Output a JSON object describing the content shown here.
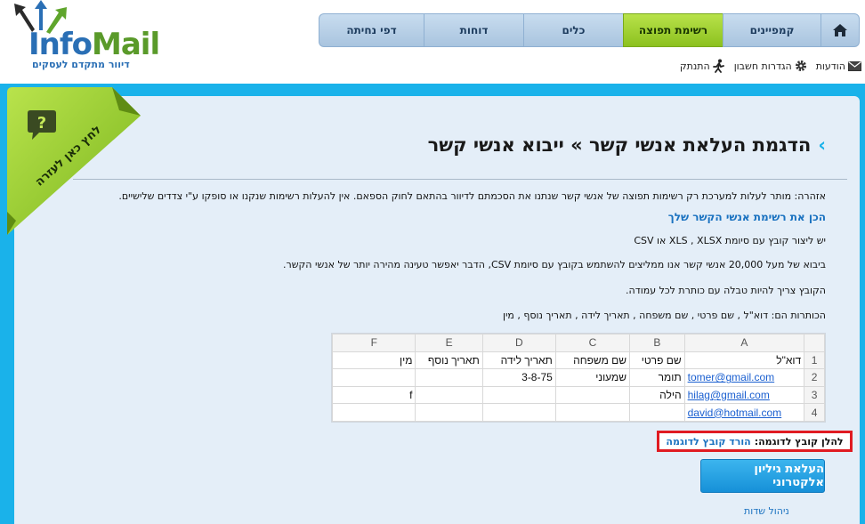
{
  "logo": {
    "brand_part1": "Info",
    "brand_part2": "Mail",
    "tagline": "דיוור מתקדם לעסקים"
  },
  "nav": {
    "tabs": [
      {
        "label": "קמפיינים"
      },
      {
        "label": "רשימת תפוצה",
        "active": true
      },
      {
        "label": "כלים"
      },
      {
        "label": "דוחות"
      },
      {
        "label": "דפי נחיתה"
      }
    ]
  },
  "util": {
    "messages": "הודעות",
    "account_settings": "הגדרות חשבון",
    "logout": "התנתק"
  },
  "help": {
    "label": "לחץ כאן לעזרה"
  },
  "page": {
    "title": "הדגמת העלאת אנשי קשר » ייבוא אנשי קשר",
    "warning": "אזהרה: מותר לעלות למערכת רק רשימות תפוצה של אנשי קשר שנתנו את הסכמתם לדיוור בהתאם לחוק הספאם. אין להעלות רשימות שנקנו או סופקו ע\"י צדדים שלישיים.",
    "section_heading": "הכן את רשימת אנשי הקשר שלך",
    "para1": "יש ליצור קובץ עם סיומת XLS , XLSX או CSV",
    "para2": "ביבוא של מעל 20,000 אנשי קשר אנו ממליצים להשתמש בקובץ עם סיומת CSV, הדבר יאפשר טעינה מהירה יותר של אנשי הקשר.",
    "para3": "הקובץ צריך להיות טבלה עם כותרת לכל עמודה.",
    "para4": "הכותרות הם: דוא\"ל , שם פרטי , שם משפחה , תאריך לידה , תאריך נוסף , מין"
  },
  "sheet": {
    "col_letters": [
      "A",
      "B",
      "C",
      "D",
      "E",
      "F"
    ],
    "row_numbers": [
      "1",
      "2",
      "3",
      "4"
    ],
    "rows": [
      [
        "דוא\"ל",
        "שם פרטי",
        "שם משפחה",
        "תאריך לידה",
        "תאריך נוסף",
        "מין"
      ],
      [
        "tomer@gmail.com",
        "תומר",
        "שמעוני",
        "3-8-75",
        "",
        ""
      ],
      [
        "hilag@gmail.com",
        "הילה",
        "",
        "",
        "",
        "f"
      ],
      [
        "david@hotmail.com",
        "",
        "",
        "",
        "",
        ""
      ]
    ]
  },
  "sample": {
    "label": "להלן קובץ לדוגמה:",
    "link": "הורד קובץ לדוגמה"
  },
  "upload_button": "העלאת גיליון אלקטרוני",
  "manage_fields": "ניהול שדות",
  "colors": {
    "band": "#1ab2ea",
    "panel": "#e4eef8",
    "active_tab": "#8cc11f",
    "link": "#1a72c0",
    "highlight": "#e01b22"
  }
}
